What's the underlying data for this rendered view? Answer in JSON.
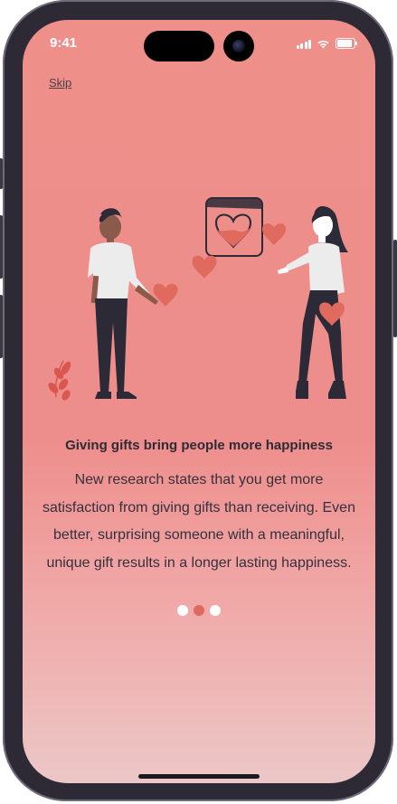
{
  "status_bar": {
    "time": "9:41"
  },
  "onboarding": {
    "skip_label": "Skip",
    "title": "Giving gifts bring people more happiness",
    "body_lines": [
      "New research states that you get more",
      "satisfaction from giving gifts than receiving. Even",
      "better, surprising someone with a meaningful,",
      "unique gift results in a longer lasting happiness."
    ],
    "page_count": 3,
    "active_page": 2
  },
  "colors": {
    "background_top": "#ef8f8a",
    "background_bottom": "#ecc7c7",
    "heart": "#e06a5e",
    "dark": "#2f2b36",
    "active_dot": "#e06a5e",
    "inactive_dot": "#ffffff"
  },
  "icons": [
    "cellular-signal-icon",
    "wifi-icon",
    "battery-icon",
    "heart-icon"
  ]
}
